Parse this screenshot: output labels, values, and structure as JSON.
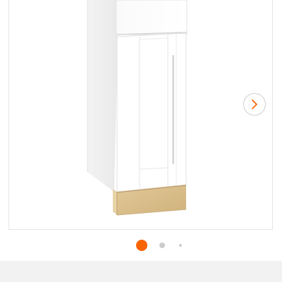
{
  "product_gallery": {
    "image_subject": "white-shaker-base-cabinet",
    "next_icon": "chevron-right-icon",
    "accent_color": "#f96302",
    "dot_color": "#cccccc",
    "slide_count": 3,
    "current_slide": 1
  }
}
